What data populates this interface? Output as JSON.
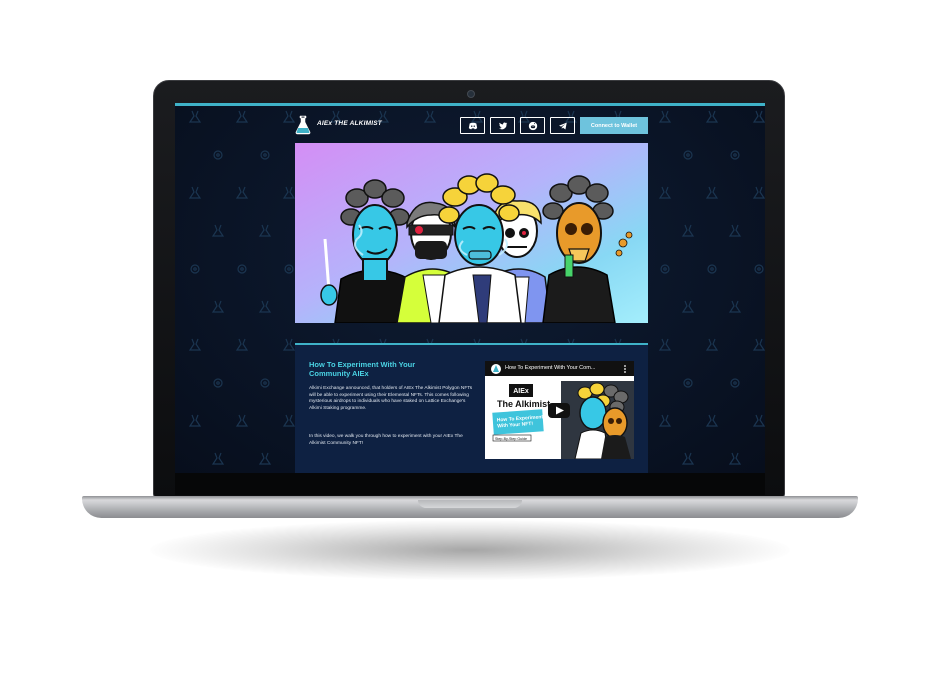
{
  "header": {
    "brand": "AIEx THE ALKIMIST",
    "social": [
      {
        "name": "discord-icon"
      },
      {
        "name": "twitter-icon"
      },
      {
        "name": "reddit-icon"
      },
      {
        "name": "telegram-icon"
      }
    ],
    "connect_label": "Connect to Wallet"
  },
  "article": {
    "title": "How To Experiment With Your Community AIEx",
    "paragraph_1": "Alkimi Exchange announced, that holders of AIEx The Alkimist Polygon NFTs will be able to experiment using their Elemental NFTs. This comes following mysterious airdrops to individuals who have staked on Lattice Exchange's Alkimi Staking programme.",
    "paragraph_2": "In this video, we walk you through how to experiment with your AIEx The Alkimist Community NFT!"
  },
  "video": {
    "title": "How To Experiment With Your Com...",
    "thumb_brand": "AIEx",
    "thumb_title": "The Alkimist",
    "thumb_subtitle": "How To Experiment With Your NFT!",
    "thumb_caption": "Step-By-Step Guide"
  },
  "colors": {
    "accent": "#3fb2c8",
    "title": "#4ad2e3",
    "button": "#6ec3dd",
    "background": "#0a1426",
    "panel": "#0e2142"
  }
}
